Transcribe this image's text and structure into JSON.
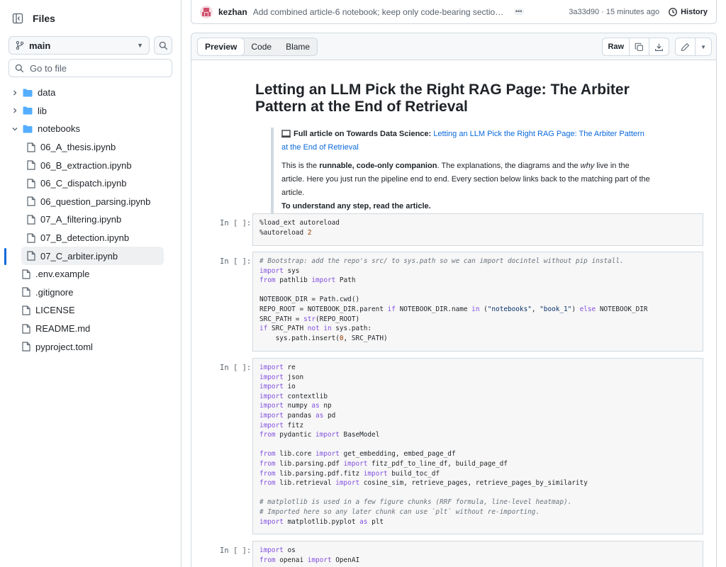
{
  "sidebar": {
    "title": "Files",
    "branch": "main",
    "goto_placeholder": "Go to file",
    "tree": [
      {
        "label": "data",
        "type": "folder",
        "expanded": false
      },
      {
        "label": "lib",
        "type": "folder",
        "expanded": false
      },
      {
        "label": "notebooks",
        "type": "folder",
        "expanded": true
      },
      {
        "label": "06_A_thesis.ipynb",
        "type": "file",
        "depth": 1
      },
      {
        "label": "06_B_extraction.ipynb",
        "type": "file",
        "depth": 1
      },
      {
        "label": "06_C_dispatch.ipynb",
        "type": "file",
        "depth": 1
      },
      {
        "label": "06_question_parsing.ipynb",
        "type": "file",
        "depth": 1
      },
      {
        "label": "07_A_filtering.ipynb",
        "type": "file",
        "depth": 1
      },
      {
        "label": "07_B_detection.ipynb",
        "type": "file",
        "depth": 1
      },
      {
        "label": "07_C_arbiter.ipynb",
        "type": "file",
        "depth": 1,
        "selected": true
      },
      {
        "label": ".env.example",
        "type": "file",
        "depth": 0
      },
      {
        "label": ".gitignore",
        "type": "file",
        "depth": 0
      },
      {
        "label": "LICENSE",
        "type": "file",
        "depth": 0
      },
      {
        "label": "README.md",
        "type": "file",
        "depth": 0
      },
      {
        "label": "pyproject.toml",
        "type": "file",
        "depth": 0
      }
    ]
  },
  "commit": {
    "author": "kezhan",
    "message": "Add combined article-6 notebook; keep only code-bearing section links...",
    "sha_time": "3a33d90 · 15 minutes ago",
    "history_label": "History"
  },
  "viewer": {
    "tabs": [
      "Preview",
      "Code",
      "Blame"
    ],
    "active_tab": "Preview",
    "raw_label": "Raw"
  },
  "notebook": {
    "title": "Letting an LLM Pick the Right RAG Page: The Arbiter Pattern at the End of Retrieval",
    "callout_bold": "Full article on Towards Data Science:",
    "callout_link": "Letting an LLM Pick the Right RAG Page: The Arbiter Pattern at the End of Retrieval",
    "p1_a": "This is the ",
    "p1_b": "runnable, code-only companion",
    "p1_c": ". The explanations, the diagrams and the ",
    "p1_d": "why",
    "p1_e": " live in the article. Here you just run the pipeline end to end. Every section below links back to the matching part of the article.",
    "p1_f": "To understand any step, read the article.",
    "prompt": "In [ ]:"
  },
  "colors": {
    "accent": "#0969da",
    "folder": "#54aeff",
    "keyword": "#8250df",
    "comment": "#6a737d"
  }
}
